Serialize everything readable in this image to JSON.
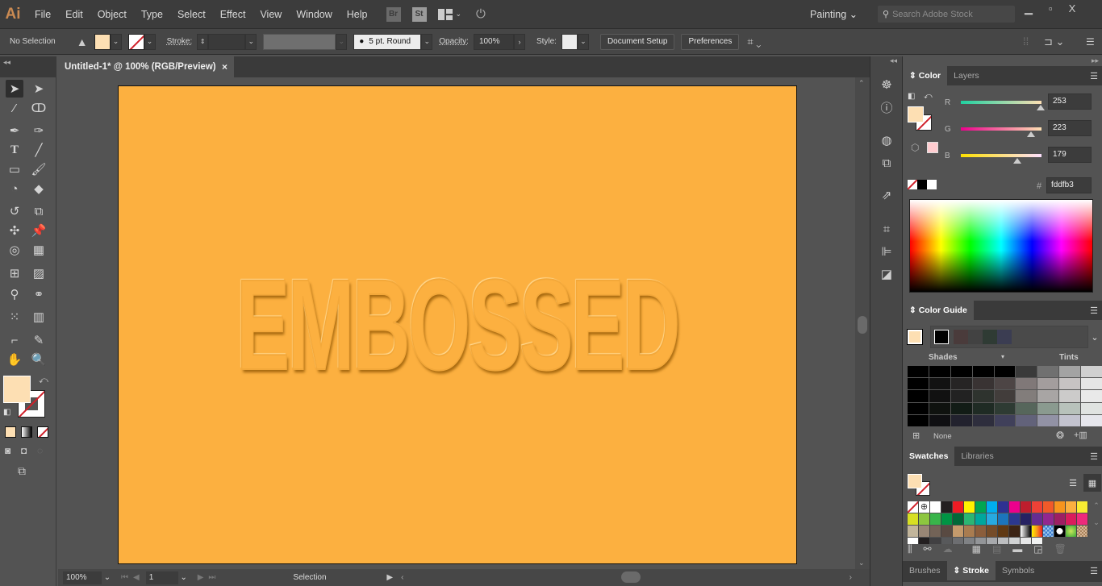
{
  "app": {
    "logo": "Ai"
  },
  "menu": [
    "File",
    "Edit",
    "Object",
    "Type",
    "Select",
    "Effect",
    "View",
    "Window",
    "Help"
  ],
  "menubar_icons": {
    "bridge": "Br",
    "stock": "St"
  },
  "workspace": {
    "label": "Painting",
    "chevron": "⌄"
  },
  "search": {
    "placeholder": "Search Adobe Stock"
  },
  "window_controls": {
    "minimize": "▁",
    "restore": "▫",
    "close": "X"
  },
  "control_bar": {
    "selection_status": "No Selection",
    "stroke_label": "Stroke:",
    "brush_label": "5 pt. Round",
    "opacity_label": "Opacity:",
    "opacity_value": "100%",
    "style_label": "Style:",
    "document_setup": "Document Setup",
    "preferences": "Preferences",
    "fill_color": "#fddfb3"
  },
  "document": {
    "tab_title": "Untitled-1* @ 100% (RGB/Preview)",
    "close": "×",
    "artboard_color": "#fcb040",
    "text": "EMBOSSED"
  },
  "status_bar": {
    "zoom": "100%",
    "artboard_number": "1",
    "tool": "Selection"
  },
  "color_panel": {
    "tabs": [
      "Color",
      "Layers"
    ],
    "channels": [
      {
        "label": "R",
        "value": "253",
        "fraction": 0.99
      },
      {
        "label": "G",
        "value": "223",
        "fraction": 0.87
      },
      {
        "label": "B",
        "value": "179",
        "fraction": 0.7
      }
    ],
    "hash": "#",
    "hex": "fddfb3"
  },
  "color_guide": {
    "title": "Color Guide",
    "shades_label": "Shades",
    "tints_label": "Tints",
    "none_label": "None",
    "harmony": [
      "#000000",
      "#4a3b3b",
      "#424242",
      "#2f3b34",
      "#3b3d52"
    ],
    "grid": [
      [
        "#000",
        "#000",
        "#000",
        "#000",
        "#000",
        "#3a3a3a",
        "#707070",
        "#a3a3a3",
        "#d0d0d0"
      ],
      [
        "#000",
        "#121212",
        "#262424",
        "#393333",
        "#4d4545",
        "#807878",
        "#a39d9d",
        "#c7c3c3",
        "#e6e6e6"
      ],
      [
        "#000",
        "#111",
        "#222",
        "#2e332e",
        "#423d3b",
        "#827d7b",
        "#a8a5a4",
        "#cccbca",
        "#e9e9e9"
      ],
      [
        "#000",
        "#0f120f",
        "#121c16",
        "#1f2b24",
        "#2e3b33",
        "#56665b",
        "#8a9a8f",
        "#b8c2bb",
        "#e0e3e1"
      ],
      [
        "#000",
        "#0f0f12",
        "#22222e",
        "#2e2e3d",
        "#40405a",
        "#62627a",
        "#9292a5",
        "#c3c3cf",
        "#e6e6ec"
      ]
    ]
  },
  "swatches_panel": {
    "tabs": [
      "Swatches",
      "Libraries"
    ],
    "rows": [
      [
        "none",
        "registration",
        "#ffffff",
        "#231f20",
        "#ed1c24",
        "#fff200",
        "#00a651",
        "#00aeef",
        "#2e3192",
        "#ec008c",
        "#be1e2d",
        "#ef4136",
        "#f15a29",
        "#f7941d",
        "#fbb040",
        "#f9ed32"
      ],
      [
        "#d7df23",
        "#8dc63f",
        "#39b54a",
        "#009444",
        "#006838",
        "#2bb673",
        "#00a79d",
        "#27aae1",
        "#1c75bc",
        "#2b388f",
        "#262262",
        "#662d91",
        "#92278f",
        "#9e1f63",
        "#da1c5c",
        "#ee2a7b"
      ],
      [
        "#c2b59b",
        "#998675",
        "#736357",
        "#594a42",
        "#c49a6c",
        "#a97c50",
        "#8b5e3c",
        "#754c29",
        "#603913",
        "#3c2415",
        "grad-bw",
        "grad-yo",
        "pattern-blue",
        "pattern-dots",
        "pattern-green",
        "pattern-brown"
      ],
      [
        "#ffffff",
        "#231f20",
        "#414042",
        "#58595b",
        "#6d6e71",
        "#808285",
        "#939598",
        "#a7a9ac",
        "#bcbec0",
        "#d1d3d4",
        "#e6e7e8",
        "#f1f2f2"
      ]
    ]
  },
  "bottom_tabs": [
    "Brushes",
    "Stroke",
    "Symbols"
  ]
}
